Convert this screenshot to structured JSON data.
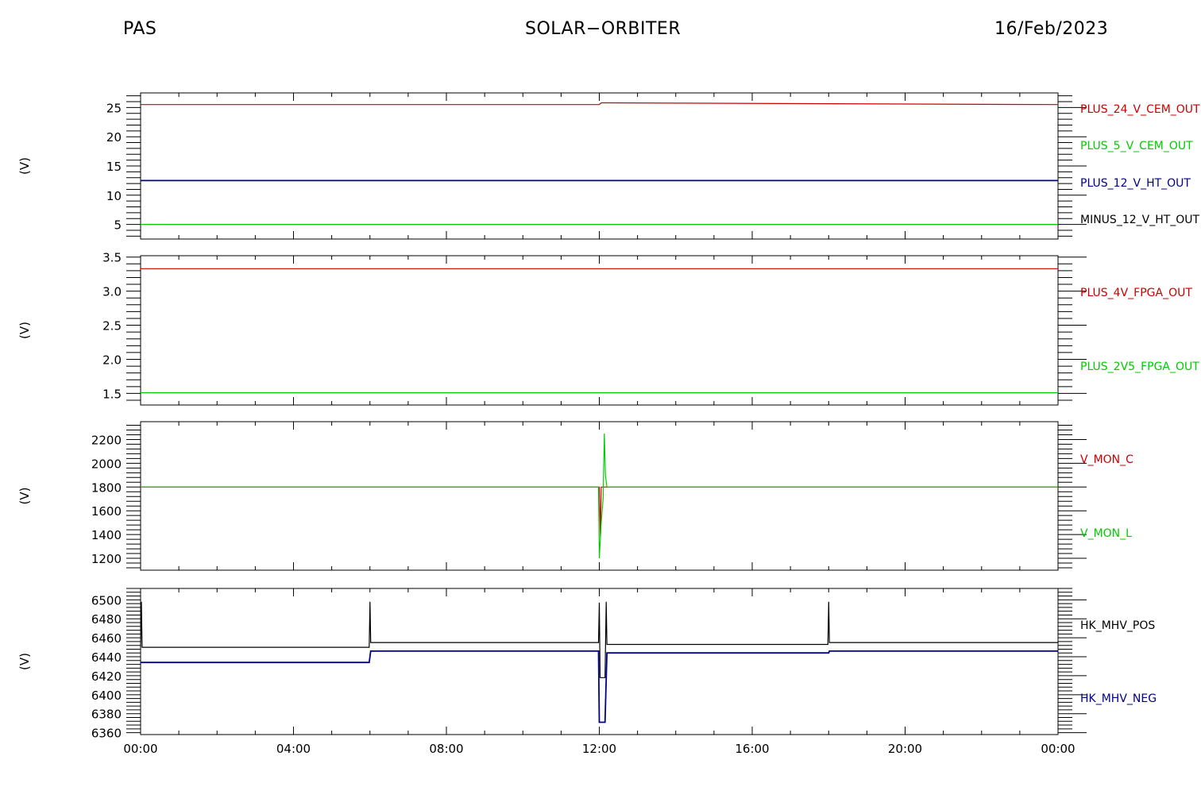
{
  "header": {
    "left": "PAS",
    "center": "SOLAR−ORBITER",
    "right": "16/Feb/2023"
  },
  "chart_data": [
    {
      "type": "line",
      "ylabel": "(V)",
      "ylim": [
        2.5,
        27.5
      ],
      "yticks": [
        5,
        10,
        15,
        20,
        25
      ],
      "ytick_labels": [
        "5",
        "10",
        "15",
        "20",
        "25"
      ],
      "xlim": [
        0,
        24
      ],
      "series": [
        {
          "name": "PLUS_24_V_CEM_OUT",
          "color": "#cc0000",
          "x": [
            0,
            12,
            12.05,
            24
          ],
          "y": [
            25.5,
            25.5,
            25.8,
            25.5
          ]
        },
        {
          "name": "PLUS_5_V_CEM_OUT",
          "color": "#00cc00",
          "x": [
            0,
            24
          ],
          "y": [
            5.0,
            5.0
          ]
        },
        {
          "name": "PLUS_12_V_HT_OUT",
          "color": "#00008b",
          "x": [
            0,
            24
          ],
          "y": [
            12.5,
            12.5
          ]
        },
        {
          "name": "MINUS_12_V_HT_OUT",
          "color": "#000000",
          "x": [],
          "y": []
        }
      ]
    },
    {
      "type": "line",
      "ylabel": "(V)",
      "ylim": [
        1.33,
        3.52
      ],
      "yticks": [
        1.5,
        2.0,
        2.5,
        3.0,
        3.5
      ],
      "ytick_labels": [
        "1.5",
        "2.0",
        "2.5",
        "3.0",
        "3.5"
      ],
      "xlim": [
        0,
        24
      ],
      "series": [
        {
          "name": "PLUS_4V_FPGA_OUT",
          "color": "#cc0000",
          "x": [
            0,
            24
          ],
          "y": [
            3.33,
            3.33
          ]
        },
        {
          "name": "PLUS_2V5_FPGA_OUT",
          "color": "#00cc00",
          "x": [
            0,
            24
          ],
          "y": [
            1.51,
            1.51
          ]
        }
      ]
    },
    {
      "type": "line",
      "ylabel": "(V)",
      "ylim": [
        1100,
        2350
      ],
      "yticks": [
        1200,
        1400,
        1600,
        1800,
        2000,
        2200
      ],
      "ytick_labels": [
        "1200",
        "1400",
        "1600",
        "1800",
        "2000",
        "2200"
      ],
      "xlim": [
        0,
        24
      ],
      "series": [
        {
          "name": "V_MON_C",
          "color": "#cc0000",
          "x": [
            0,
            12.0,
            12.03,
            12.05,
            12.08,
            24
          ],
          "y": [
            1800,
            1800,
            1380,
            1800,
            1800,
            1800
          ]
        },
        {
          "name": "V_MON_L",
          "color": "#00cc00",
          "x": [
            0,
            11.98,
            12.0,
            12.05,
            12.1,
            12.13,
            12.16,
            12.2,
            24
          ],
          "y": [
            1800,
            1800,
            1200,
            1500,
            1700,
            2250,
            1900,
            1800,
            1800
          ]
        }
      ]
    },
    {
      "type": "line",
      "ylabel": "(V)",
      "ylim": [
        6358,
        6512
      ],
      "yticks": [
        6360,
        6380,
        6400,
        6420,
        6440,
        6460,
        6480,
        6500
      ],
      "ytick_labels": [
        "6360",
        "6380",
        "6400",
        "6420",
        "6440",
        "6460",
        "6480",
        "6500"
      ],
      "xlim": [
        0,
        24
      ],
      "xticks": [
        0,
        4,
        8,
        12,
        16,
        20,
        24
      ],
      "xtick_labels": [
        "00:00",
        "04:00",
        "08:00",
        "12:00",
        "16:00",
        "20:00",
        "00:00"
      ],
      "series": [
        {
          "name": "HK_MHV_POS",
          "color": "#000000",
          "x": [
            0,
            0.02,
            0.04,
            5.98,
            6.0,
            6.02,
            6.05,
            11.98,
            12.0,
            12.02,
            12.04,
            12.15,
            12.18,
            12.2,
            17.98,
            18.0,
            18.02,
            24
          ],
          "y": [
            6450,
            6498,
            6450,
            6450,
            6498,
            6455,
            6455,
            6455,
            6497,
            6418,
            6418,
            6418,
            6498,
            6453,
            6453,
            6498,
            6455,
            6455
          ]
        },
        {
          "name": "HK_MHV_NEG",
          "color": "#00008b",
          "x": [
            0,
            0.05,
            5.98,
            6.02,
            11.98,
            12.0,
            12.15,
            12.2,
            18.0,
            18.02,
            24
          ],
          "y": [
            6434,
            6434,
            6434,
            6446,
            6446,
            6371,
            6371,
            6444,
            6444,
            6446,
            6446
          ]
        }
      ]
    }
  ]
}
